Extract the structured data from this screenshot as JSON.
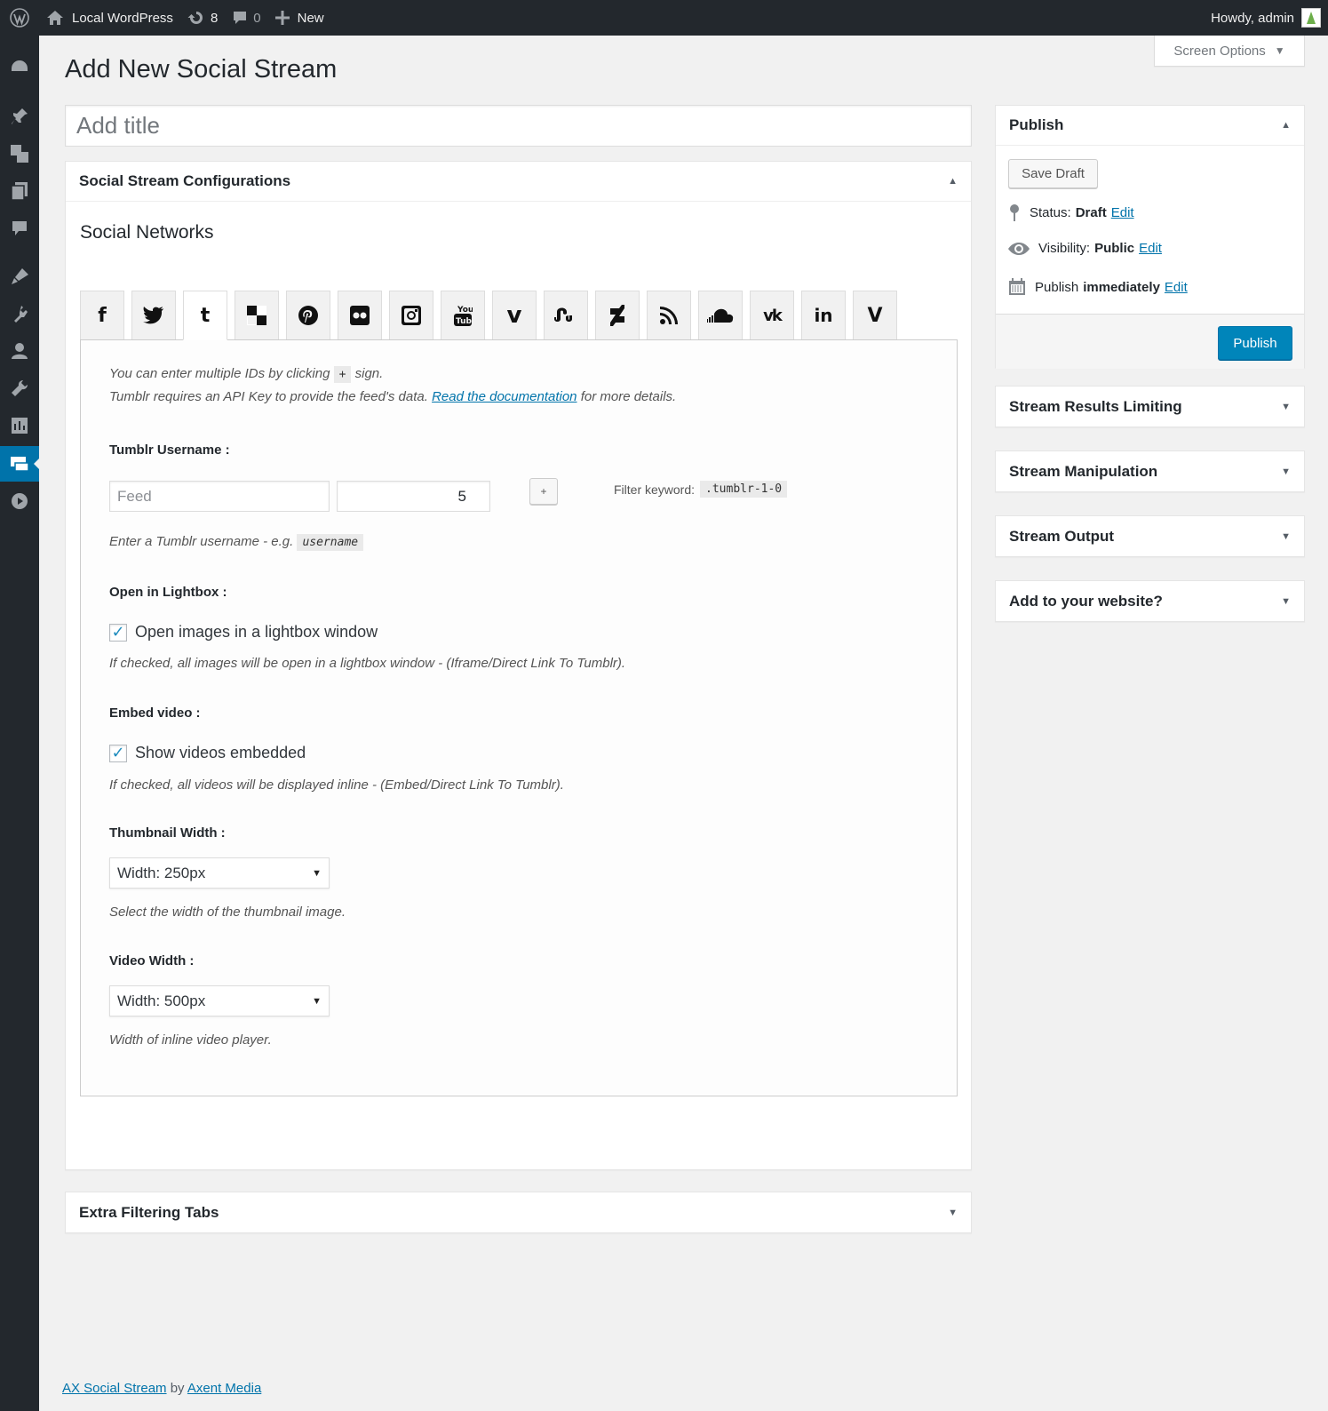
{
  "adminbar": {
    "site_name": "Local WordPress",
    "updates_count": "8",
    "comments_count": "0",
    "new_label": "New",
    "howdy": "Howdy, admin"
  },
  "sidebar": {
    "icons": [
      "dashboard-icon",
      "posts-icon",
      "media-icon",
      "pages-icon",
      "comments-icon",
      "appearance-icon",
      "plugins-icon",
      "users-icon",
      "tools-icon",
      "settings-icon",
      "social-stream-icon",
      "play-icon"
    ],
    "current": "social-stream-icon"
  },
  "screen_options": {
    "label": "Screen Options",
    "arrow": "▼"
  },
  "page": {
    "title": "Add New Social Stream",
    "title_placeholder": "Add title"
  },
  "config_box": {
    "heading": "Social Stream Configurations",
    "toggle": "▲",
    "section_title": "Social Networks",
    "networks": [
      "facebook",
      "twitter",
      "tumblr",
      "delicious",
      "pinterest",
      "flickr",
      "instagram",
      "youtube",
      "vimeo",
      "stumbleupon",
      "deviantart",
      "rss",
      "soundcloud",
      "vk",
      "linkedin",
      "vine"
    ],
    "active_network": "tumblr",
    "intro_line1_pre": "You can enter multiple IDs by clicking",
    "intro_plus": "+",
    "intro_line1_post": "sign.",
    "intro_line2_pre": "Tumblr requires an API Key to provide the feed's data.",
    "intro_link": "Read the documentation",
    "intro_line2_post": "for more details.",
    "username_label": "Tumblr Username :",
    "feed_placeholder": "Feed",
    "count_value": "5",
    "add_button": "+",
    "filter_keyword_label": "Filter keyword:",
    "filter_keyword_value": ".tumblr-1-0",
    "username_help_pre": "Enter a Tumblr username - e.g.",
    "username_help_code": "username",
    "lightbox_label": "Open in Lightbox :",
    "lightbox_checkbox": "Open images in a lightbox window",
    "lightbox_help": "If checked, all images will be open in a lightbox window - (Iframe/Direct Link To Tumblr).",
    "embed_label": "Embed video :",
    "embed_checkbox": "Show videos embedded",
    "embed_help": "If checked, all videos will be displayed inline - (Embed/Direct Link To Tumblr).",
    "thumb_label": "Thumbnail Width :",
    "thumb_value": "Width: 250px",
    "thumb_help": "Select the width of the thumbnail image.",
    "video_label": "Video Width :",
    "video_value": "Width: 500px",
    "video_help": "Width of inline video player."
  },
  "extra_box": {
    "heading": "Extra Filtering Tabs",
    "toggle": "▼"
  },
  "publish": {
    "heading": "Publish",
    "toggle": "▲",
    "save_draft": "Save Draft",
    "status_label": "Status:",
    "status_value": "Draft",
    "visibility_label": "Visibility:",
    "visibility_value": "Public",
    "schedule_label": "Publish",
    "schedule_value": "immediately",
    "edit": "Edit",
    "publish_button": "Publish"
  },
  "side_boxes": [
    {
      "heading": "Stream Results Limiting",
      "toggle": "▼"
    },
    {
      "heading": "Stream Manipulation",
      "toggle": "▼"
    },
    {
      "heading": "Stream Output",
      "toggle": "▼"
    },
    {
      "heading": "Add to your website?",
      "toggle": "▼"
    }
  ],
  "footer": {
    "plugin_link": "AX Social Stream",
    "by": "by",
    "author_link": "Axent Media"
  }
}
